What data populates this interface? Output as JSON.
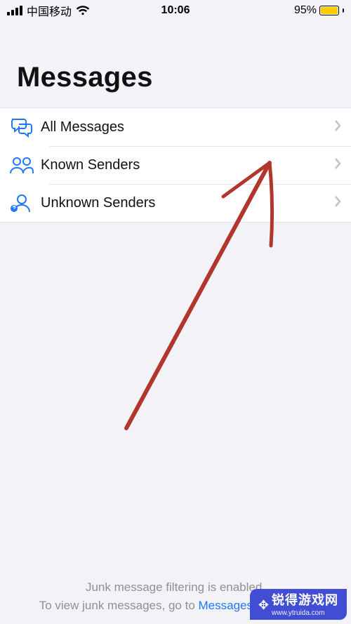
{
  "statusBar": {
    "carrier": "中国移动",
    "time": "10:06",
    "batteryPercentText": "95%",
    "batteryFraction": 0.95
  },
  "header": {
    "title": "Messages"
  },
  "filters": [
    {
      "icon": "speech-bubbles-icon",
      "label": "All Messages"
    },
    {
      "icon": "known-senders-icon",
      "label": "Known Senders"
    },
    {
      "icon": "unknown-senders-icon",
      "label": "Unknown Senders"
    }
  ],
  "footer": {
    "line1": "Junk message filtering is enabled.",
    "line2_prefix": "To view junk messages, go to ",
    "line2_link": "Messages Settings"
  },
  "watermark": {
    "title": "锐得游戏网",
    "url": "www.ytruida.com"
  }
}
